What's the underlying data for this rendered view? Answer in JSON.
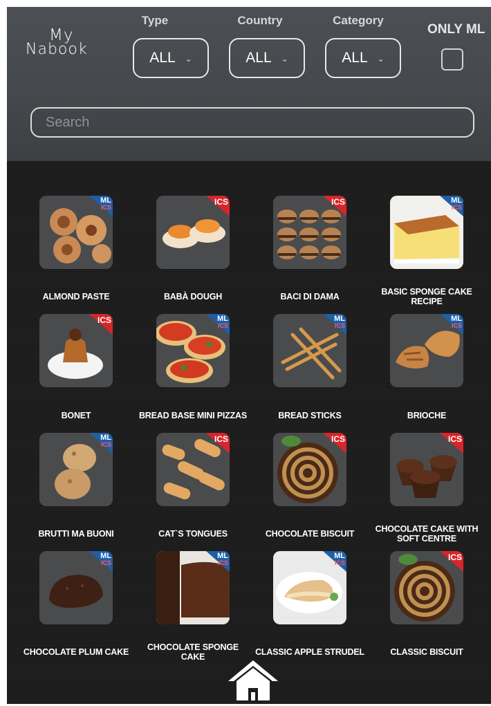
{
  "app": {
    "logo_line1": "My",
    "logo_line2": "Nabook"
  },
  "filters": {
    "type": {
      "label": "Type",
      "value": "ALL"
    },
    "country": {
      "label": "Country",
      "value": "ALL"
    },
    "category": {
      "label": "Category",
      "value": "ALL"
    },
    "only_ml": {
      "label": "ONLY ML",
      "checked": false
    }
  },
  "search": {
    "placeholder": "Search",
    "value": ""
  },
  "colors": {
    "ics_badge": "#d7262a",
    "ml_badge": "#1e5fa7",
    "background": "#1c1c1d",
    "header": "#4a4d51"
  },
  "badge_labels": {
    "ics": "ICS",
    "ml": "ML"
  },
  "recipes": [
    {
      "name": "ALMOND PASTE",
      "badge": "ml-ics",
      "icon": "almond-paste-pastry-image"
    },
    {
      "name": "BABÀ DOUGH",
      "badge": "ics",
      "icon": "baba-dough-image"
    },
    {
      "name": "BACI DI DAMA",
      "badge": "ics",
      "icon": "baci-di-dama-cookies-image"
    },
    {
      "name": "BASIC SPONGE CAKE RECIPE",
      "badge": "ml-ics",
      "icon": "sponge-cake-image"
    },
    {
      "name": "BONET",
      "badge": "ics",
      "icon": "bonet-dessert-image"
    },
    {
      "name": "BREAD BASE MINI PIZZAS",
      "badge": "ml-ics",
      "icon": "mini-pizzas-image"
    },
    {
      "name": "BREAD STICKS",
      "badge": "ml-ics",
      "icon": "bread-sticks-image"
    },
    {
      "name": "BRIOCHE",
      "badge": "ml-ics",
      "icon": "brioche-croissant-image"
    },
    {
      "name": "BRUTTI MA BUONI",
      "badge": "ml-ics",
      "icon": "brutti-ma-buoni-cookies-image"
    },
    {
      "name": "CAT`S TONGUES",
      "badge": "ics",
      "icon": "cats-tongues-biscuits-image"
    },
    {
      "name": "CHOCOLATE BISCUIT",
      "badge": "ics",
      "icon": "chocolate-roll-image"
    },
    {
      "name": "CHOCOLATE CAKE WITH SOFT CENTRE",
      "badge": "ics",
      "icon": "chocolate-muffins-image"
    },
    {
      "name": "CHOCOLATE PLUM CAKE",
      "badge": "ml-ics",
      "icon": "chocolate-plum-cake-image"
    },
    {
      "name": "CHOCOLATE SPONGE CAKE",
      "badge": "ml-ics",
      "icon": "chocolate-sponge-cake-image"
    },
    {
      "name": "CLASSIC APPLE STRUDEL",
      "badge": "ml-ics",
      "icon": "apple-strudel-image"
    },
    {
      "name": "CLASSIC BISCUIT",
      "badge": "ics",
      "icon": "classic-roll-image"
    }
  ]
}
